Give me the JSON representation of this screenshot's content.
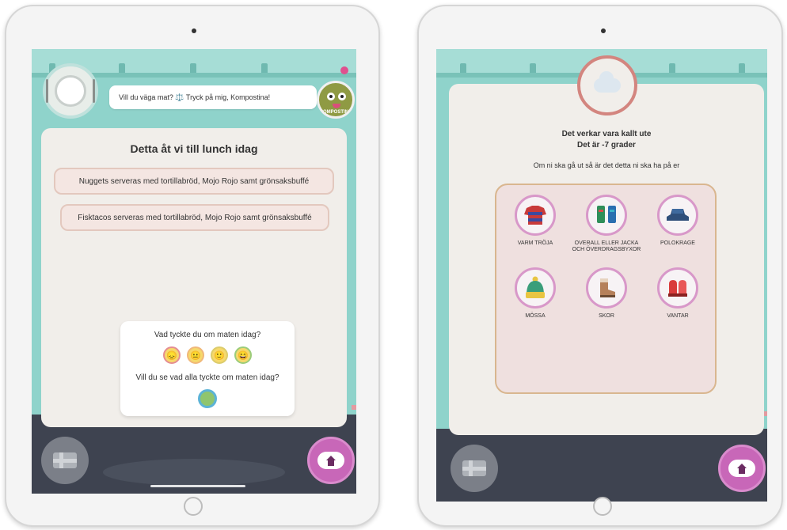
{
  "left_screen": {
    "speech_text": "Vill du väga mat? ⚖️ Tryck på mig, Kompostina!",
    "mascot_label": "KOMPOSTINA",
    "lunch_title": "Detta åt vi till lunch idag",
    "menu_items": [
      "Nuggets serveras med tortillabröd, Mojo Rojo samt grönsaksbuffé",
      "Fisktacos serveras med tortillabröd, Mojo Rojo samt grönsaksbuffé"
    ],
    "rating_question": "Vad tyckte du om maten idag?",
    "results_question": "Vill du se vad alla tyckte om maten idag?",
    "smileys": [
      "😞",
      "😐",
      "🙂",
      "😄"
    ],
    "colors": {
      "smiley_border_1": "#e58d92",
      "smiley_border_2": "#f0b87a",
      "smiley_border_3": "#dccc6c",
      "smiley_border_4": "#9bcc7a"
    }
  },
  "right_screen": {
    "weather_line1": "Det verkar vara kallt ute",
    "weather_line2": "Det är -7 grader",
    "instruction": "Om ni ska gå ut så är det detta ni ska ha på er",
    "clothes": [
      {
        "label": "VARM TRÖJA",
        "icon": "sweater-icon"
      },
      {
        "label": "OVERALL ELLER JACKA OCH ÖVERDRAGSBYXOR",
        "icon": "overall-icon"
      },
      {
        "label": "POLOKRAGE",
        "icon": "polo-collar-icon"
      },
      {
        "label": "MÖSSA",
        "icon": "beanie-icon"
      },
      {
        "label": "SKOR",
        "icon": "boot-icon"
      },
      {
        "label": "VANTAR",
        "icon": "mittens-icon"
      }
    ]
  },
  "icons": {
    "plate": "plate-icon",
    "cloud": "cloud-icon",
    "flag": "swedish-flag-icon",
    "home": "home-icon"
  },
  "colors": {
    "wall": "#8fd3cb",
    "ground": "#3e4350",
    "home_button": "#c867b8",
    "panel": "#f1eeea"
  }
}
